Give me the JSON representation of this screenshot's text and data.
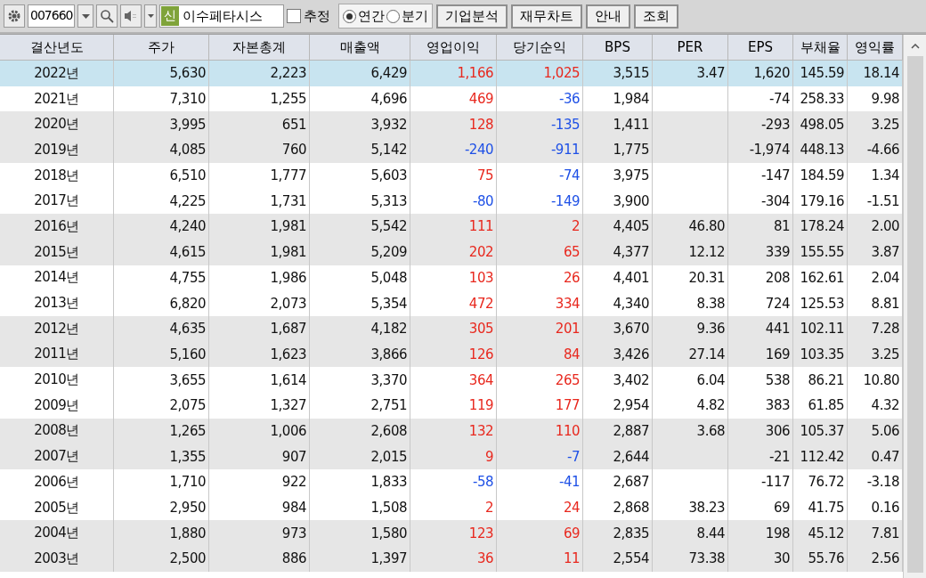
{
  "toolbar": {
    "code": "007660",
    "badge": "신",
    "company": "이수페타시스",
    "estimate": {
      "label": "추정",
      "checked": false
    },
    "periods": [
      {
        "label": "연간",
        "selected": true
      },
      {
        "label": "분기",
        "selected": false
      }
    ],
    "buttons": [
      "기업분석",
      "재무차트",
      "안내",
      "조회"
    ]
  },
  "table": {
    "columns": [
      "결산년도",
      "주가",
      "자본총계",
      "매출액",
      "영업이익",
      "당기순익",
      "BPS",
      "PER",
      "EPS",
      "부채율",
      "영익률"
    ],
    "rows": [
      {
        "selected": true,
        "cells": [
          "2022년",
          "5,630",
          "2,223",
          "6,429",
          {
            "text": "1,166",
            "color": "#e8281e"
          },
          {
            "text": "1,025",
            "color": "#e8281e"
          },
          "3,515",
          "3.47",
          "1,620",
          "145.59",
          "18.14"
        ]
      },
      {
        "selected": false,
        "cells": [
          "2021년",
          "7,310",
          "1,255",
          "4,696",
          {
            "text": "469",
            "color": "#e8281e"
          },
          {
            "text": "-36",
            "color": "#1e50e6"
          },
          "1,984",
          "",
          "-74",
          "258.33",
          "9.98"
        ]
      },
      {
        "selected": false,
        "cells": [
          "2020년",
          "3,995",
          "651",
          "3,932",
          {
            "text": "128",
            "color": "#e8281e"
          },
          {
            "text": "-135",
            "color": "#1e50e6"
          },
          "1,411",
          "",
          "-293",
          "498.05",
          "3.25"
        ]
      },
      {
        "selected": false,
        "cells": [
          "2019년",
          "4,085",
          "760",
          "5,142",
          {
            "text": "-240",
            "color": "#1e50e6"
          },
          {
            "text": "-911",
            "color": "#1e50e6"
          },
          "1,775",
          "",
          "-1,974",
          "448.13",
          "-4.66"
        ]
      },
      {
        "selected": false,
        "cells": [
          "2018년",
          "6,510",
          "1,777",
          "5,603",
          {
            "text": "75",
            "color": "#e8281e"
          },
          {
            "text": "-74",
            "color": "#1e50e6"
          },
          "3,975",
          "",
          "-147",
          "184.59",
          "1.34"
        ]
      },
      {
        "selected": false,
        "cells": [
          "2017년",
          "4,225",
          "1,731",
          "5,313",
          {
            "text": "-80",
            "color": "#1e50e6"
          },
          {
            "text": "-149",
            "color": "#1e50e6"
          },
          "3,900",
          "",
          "-304",
          "179.16",
          "-1.51"
        ]
      },
      {
        "selected": false,
        "cells": [
          "2016년",
          "4,240",
          "1,981",
          "5,542",
          {
            "text": "111",
            "color": "#e8281e"
          },
          {
            "text": "2",
            "color": "#e8281e"
          },
          "4,405",
          "46.80",
          "81",
          "178.24",
          "2.00"
        ]
      },
      {
        "selected": false,
        "cells": [
          "2015년",
          "4,615",
          "1,981",
          "5,209",
          {
            "text": "202",
            "color": "#e8281e"
          },
          {
            "text": "65",
            "color": "#e8281e"
          },
          "4,377",
          "12.12",
          "339",
          "155.55",
          "3.87"
        ]
      },
      {
        "selected": false,
        "cells": [
          "2014년",
          "4,755",
          "1,986",
          "5,048",
          {
            "text": "103",
            "color": "#e8281e"
          },
          {
            "text": "26",
            "color": "#e8281e"
          },
          "4,401",
          "20.31",
          "208",
          "162.61",
          "2.04"
        ]
      },
      {
        "selected": false,
        "cells": [
          "2013년",
          "6,820",
          "2,073",
          "5,354",
          {
            "text": "472",
            "color": "#e8281e"
          },
          {
            "text": "334",
            "color": "#e8281e"
          },
          "4,340",
          "8.38",
          "724",
          "125.53",
          "8.81"
        ]
      },
      {
        "selected": false,
        "cells": [
          "2012년",
          "4,635",
          "1,687",
          "4,182",
          {
            "text": "305",
            "color": "#e8281e"
          },
          {
            "text": "201",
            "color": "#e8281e"
          },
          "3,670",
          "9.36",
          "441",
          "102.11",
          "7.28"
        ]
      },
      {
        "selected": false,
        "cells": [
          "2011년",
          "5,160",
          "1,623",
          "3,866",
          {
            "text": "126",
            "color": "#e8281e"
          },
          {
            "text": "84",
            "color": "#e8281e"
          },
          "3,426",
          "27.14",
          "169",
          "103.35",
          "3.25"
        ]
      },
      {
        "selected": false,
        "cells": [
          "2010년",
          "3,655",
          "1,614",
          "3,370",
          {
            "text": "364",
            "color": "#e8281e"
          },
          {
            "text": "265",
            "color": "#e8281e"
          },
          "3,402",
          "6.04",
          "538",
          "86.21",
          "10.80"
        ]
      },
      {
        "selected": false,
        "cells": [
          "2009년",
          "2,075",
          "1,327",
          "2,751",
          {
            "text": "119",
            "color": "#e8281e"
          },
          {
            "text": "177",
            "color": "#e8281e"
          },
          "2,954",
          "4.82",
          "383",
          "61.85",
          "4.32"
        ]
      },
      {
        "selected": false,
        "cells": [
          "2008년",
          "1,265",
          "1,006",
          "2,608",
          {
            "text": "132",
            "color": "#e8281e"
          },
          {
            "text": "110",
            "color": "#e8281e"
          },
          "2,887",
          "3.68",
          "306",
          "105.37",
          "5.06"
        ]
      },
      {
        "selected": false,
        "cells": [
          "2007년",
          "1,355",
          "907",
          "2,015",
          {
            "text": "9",
            "color": "#e8281e"
          },
          {
            "text": "-7",
            "color": "#1e50e6"
          },
          "2,644",
          "",
          "-21",
          "112.42",
          "0.47"
        ]
      },
      {
        "selected": false,
        "cells": [
          "2006년",
          "1,710",
          "922",
          "1,833",
          {
            "text": "-58",
            "color": "#1e50e6"
          },
          {
            "text": "-41",
            "color": "#1e50e6"
          },
          "2,687",
          "",
          "-117",
          "76.72",
          "-3.18"
        ]
      },
      {
        "selected": false,
        "cells": [
          "2005년",
          "2,950",
          "984",
          "1,508",
          {
            "text": "2",
            "color": "#e8281e"
          },
          {
            "text": "24",
            "color": "#e8281e"
          },
          "2,868",
          "38.23",
          "69",
          "41.75",
          "0.16"
        ]
      },
      {
        "selected": false,
        "cells": [
          "2004년",
          "1,880",
          "973",
          "1,580",
          {
            "text": "123",
            "color": "#e8281e"
          },
          {
            "text": "69",
            "color": "#e8281e"
          },
          "2,835",
          "8.44",
          "198",
          "45.12",
          "7.81"
        ]
      },
      {
        "selected": false,
        "cells": [
          "2003년",
          "2,500",
          "886",
          "1,397",
          {
            "text": "36",
            "color": "#e8281e"
          },
          {
            "text": "11",
            "color": "#e8281e"
          },
          "2,554",
          "73.38",
          "30",
          "55.76",
          "2.56"
        ]
      }
    ]
  }
}
